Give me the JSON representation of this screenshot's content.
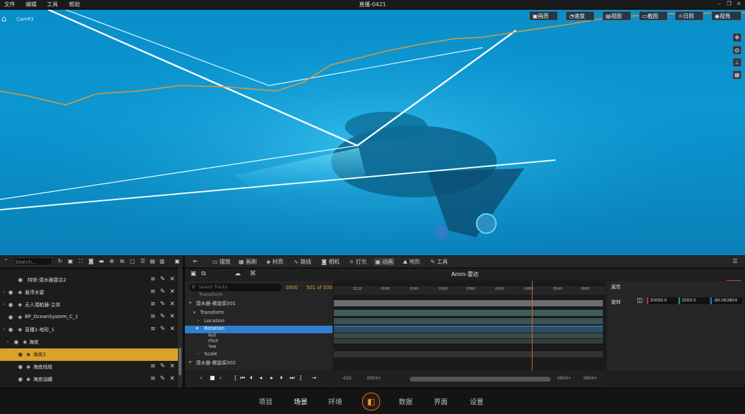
{
  "menu": {
    "file": "文件",
    "edit": "编辑",
    "tools": "工具",
    "help": "帮助"
  },
  "window_title": "直播-0421",
  "viewport": {
    "camera_label": "CamP3",
    "toolbar": [
      {
        "label": "画质",
        "icon": "image-icon"
      },
      {
        "label": "速度",
        "icon": "speed-icon"
      },
      {
        "label": "视图",
        "icon": "view-icon"
      },
      {
        "label": "截图",
        "icon": "screenshot-icon"
      },
      {
        "label": "日照",
        "icon": "sun-icon"
      },
      {
        "label": "视角",
        "icon": "eye-icon"
      }
    ]
  },
  "outliner": {
    "search_placeholder": "Search...",
    "rows": [
      {
        "label": "特效-潜水器雷达2"
      },
      {
        "label": "悬浮水雷"
      },
      {
        "label": "无人潜航器-主体"
      },
      {
        "label": "BP_OceanSystem_C_1"
      },
      {
        "label": "直播1-地形_1"
      },
      {
        "label": "海底"
      },
      {
        "label": "海底2"
      },
      {
        "label": "海底线缆"
      },
      {
        "label": "海底油罐"
      }
    ]
  },
  "tabs": [
    {
      "label": "摆放"
    },
    {
      "label": "画刷"
    },
    {
      "label": "材质"
    },
    {
      "label": "路线"
    },
    {
      "label": "相机"
    },
    {
      "label": "灯光"
    },
    {
      "label": "动画"
    },
    {
      "label": "地形"
    },
    {
      "label": "工具"
    }
  ],
  "anim": {
    "title": "Anim-雷达",
    "search_placeholder": "Search Tracks",
    "frame_current": "0500",
    "frame_range": "501 of 500",
    "tracks": [
      {
        "label": "Transform"
      },
      {
        "label": "潜水器-螺旋桨001"
      },
      {
        "label": "Transform"
      },
      {
        "label": "Location"
      },
      {
        "label": "Rotation"
      },
      {
        "label": "Roll"
      },
      {
        "label": "Pitch"
      },
      {
        "label": "Yaw"
      },
      {
        "label": "Scale"
      },
      {
        "label": "潜水器-螺旋桨002"
      }
    ],
    "ruler_ticks": [
      "0120",
      "0180",
      "0240",
      "0300",
      "0360",
      "0420",
      "0480",
      "0540",
      "0600"
    ],
    "playhead": "0500",
    "foot": {
      "start": "-015",
      "start2": "0003+",
      "end": "0650+",
      "end2": "0650+"
    },
    "props": {
      "title": "属性",
      "label": "旋转",
      "x": "30000.0",
      "y": "3000.0",
      "z": "-90.063804"
    }
  },
  "bottom_nav": [
    {
      "label": "项目"
    },
    {
      "label": "场景"
    },
    {
      "label": "环境"
    },
    {
      "label": "数据"
    },
    {
      "label": "界面"
    },
    {
      "label": "设置"
    }
  ]
}
